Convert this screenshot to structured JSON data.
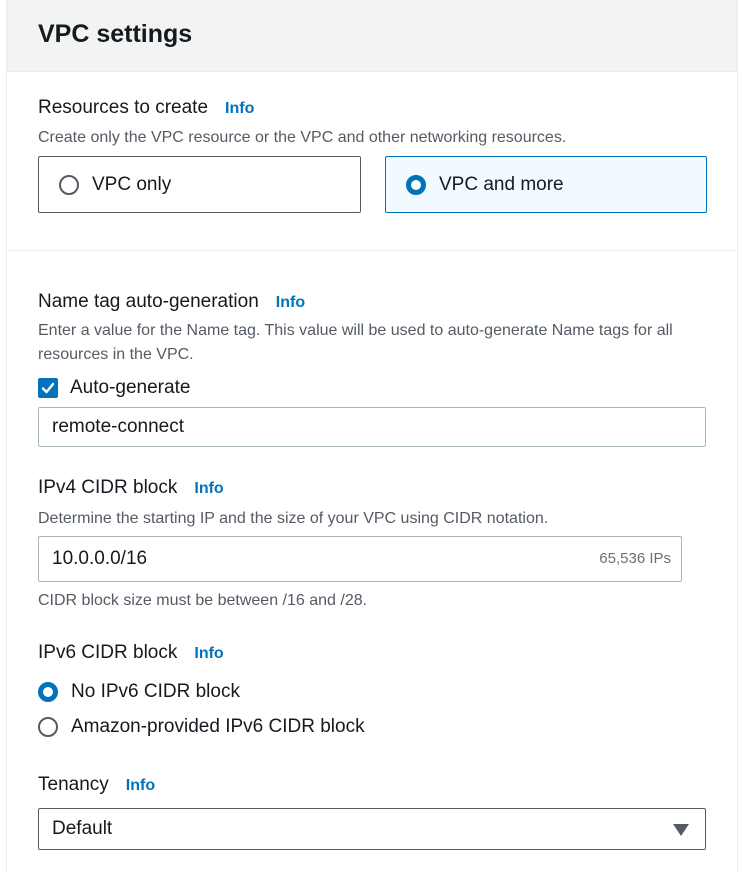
{
  "panel": {
    "title": "VPC settings"
  },
  "resources": {
    "label": "Resources to create",
    "info": "Info",
    "description": "Create only the VPC resource or the VPC and other networking resources.",
    "options": [
      {
        "label": "VPC only",
        "selected": false
      },
      {
        "label": "VPC and more",
        "selected": true
      }
    ]
  },
  "name_tag": {
    "label": "Name tag auto-generation",
    "info": "Info",
    "description": "Enter a value for the Name tag. This value will be used to auto-generate Name tags for all resources in the VPC.",
    "checkbox_label": "Auto-generate",
    "checked": true,
    "value": "remote-connect"
  },
  "ipv4": {
    "label": "IPv4 CIDR block",
    "info": "Info",
    "description": "Determine the starting IP and the size of your VPC using CIDR notation.",
    "value": "10.0.0.0/16",
    "suffix": "65,536 IPs",
    "constraint": "CIDR block size must be between /16 and /28."
  },
  "ipv6": {
    "label": "IPv6 CIDR block",
    "info": "Info",
    "options": [
      {
        "label": "No IPv6 CIDR block",
        "selected": true
      },
      {
        "label": "Amazon-provided IPv6 CIDR block",
        "selected": false
      }
    ]
  },
  "tenancy": {
    "label": "Tenancy",
    "info": "Info",
    "value": "Default"
  },
  "colors": {
    "accent": "#0073bb",
    "text": "#16191f",
    "muted": "#545b64"
  }
}
